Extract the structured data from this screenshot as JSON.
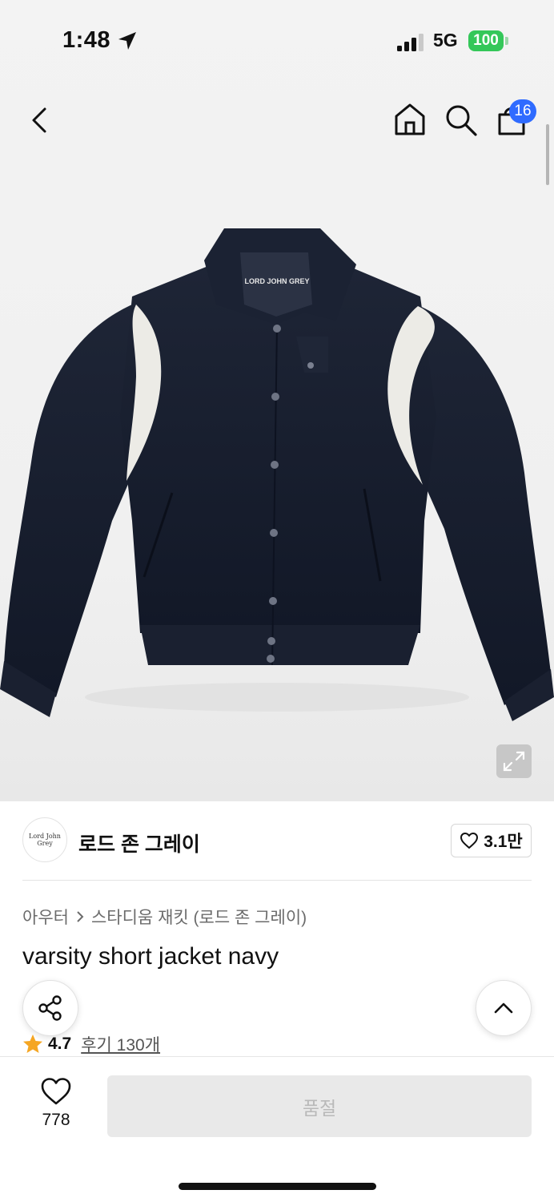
{
  "status_bar": {
    "time": "1:48",
    "network": "5G",
    "battery": "100"
  },
  "nav": {
    "back_icon": "chevron-left-icon",
    "home_icon": "home-icon",
    "search_icon": "search-icon",
    "bag_icon": "shopping-bag-icon",
    "cart_count": "16"
  },
  "product_image": {
    "label": "LORD JOHN GREY"
  },
  "brand": {
    "logo_text": "Lord John Grey",
    "name": "로드 존 그레이",
    "likes": "3.1만"
  },
  "breadcrumb": {
    "category": "아우터",
    "subcategory": "스타디움 재킷 (로드 존 그레이)"
  },
  "product": {
    "title": "varsity short jacket navy",
    "rating": "4.7",
    "reviews": "후기 130개"
  },
  "bottom": {
    "wish_count": "778",
    "buy_label": "품절"
  },
  "colors": {
    "accent_blue": "#2f6bff",
    "battery_green": "#34c759",
    "star": "#f5a623",
    "jacket_navy": "#161c2c"
  }
}
